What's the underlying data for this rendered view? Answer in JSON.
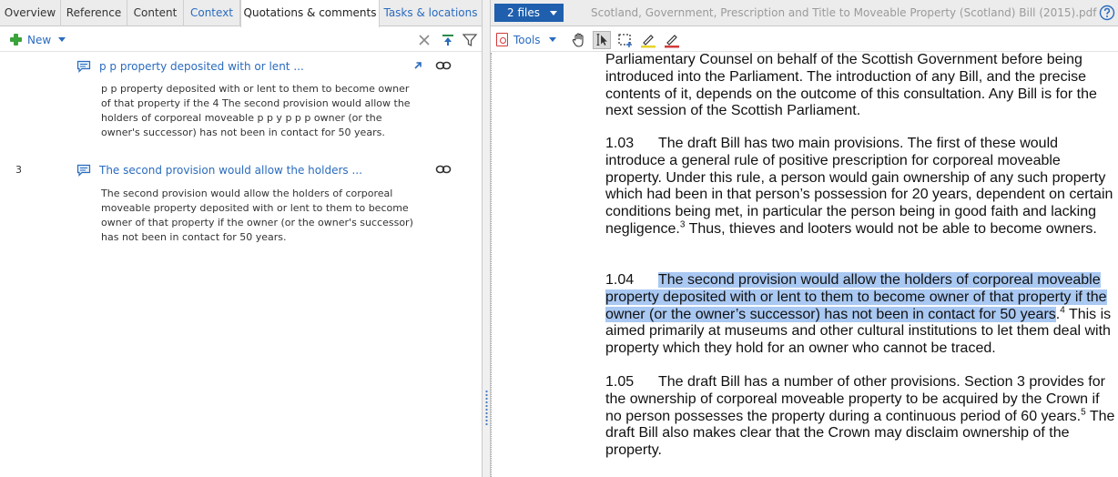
{
  "left_tabs": [
    "Overview",
    "Reference",
    "Content",
    "Context",
    "Quotations & comments",
    "Tasks & locations"
  ],
  "left_toolbar": {
    "new_label": "New"
  },
  "entries": [
    {
      "number": "",
      "title": "p p property deposited with or lent ...",
      "body": "p p property deposited with or lent to them to become owner of that property if the 4 The second provision would allow the holders of corporeal moveable p p y p p p owner (or the owner's successor) has not been in contact for 50 years."
    },
    {
      "number": "3",
      "title": "The second provision would allow the holders ...",
      "body": "The second provision would allow the holders of corporeal moveable property deposited with or lent to them to become owner of that property if the owner (or the owner's successor) has not been in contact for 50 years."
    }
  ],
  "right_header": {
    "files_label": "2 files",
    "doc_title": "Scotland, Government, Prescription and Title to Moveable Property (Scotland) Bill (2015).pdf"
  },
  "right_toolbar": {
    "tools_label": "Tools"
  },
  "document": {
    "p0": "Parliamentary Counsel on behalf of the Scottish Government before being introduced into the Parliament.    The introduction of any Bill, and the precise contents of it, depends on the outcome of this consultation.  Any Bill is for the next session of the Scottish Parliament.",
    "p1_num": "1.03",
    "p1_text": "The draft Bill has two main provisions. The first of these would introduce a general rule of positive prescription for corporeal moveable property. Under this rule, a person would gain ownership of any such property which had been in that person’s possession for 20 years, dependent on certain conditions being met, in particular the person being in good faith and lacking  negligence.",
    "p1_sup": "3",
    "p1_tail": " Thus, thieves and looters would not be able to become owners.",
    "p2_num": "1.04",
    "p2_highlight": "The second provision would allow the holders of corporeal moveable property deposited with or lent to them to become owner of that property if the owner (or the owner’s successor) has not been in contact for 50 years",
    "p2_after_hl": ".",
    "p2_sup": "4",
    "p2_tail": " This is aimed primarily at museums and other cultural institutions to let them deal with property which they hold for an owner who cannot be traced.",
    "p3_num": "1.05",
    "p3_text": "The draft Bill has a number of other provisions. Section 3 provides for the ownership of corporeal moveable property to be acquired by the Crown if no person possesses the property during a continuous period of 60 years.",
    "p3_sup": "5",
    "p3_tail": " The draft Bill also makes clear that the Crown may disclaim ownership of the property."
  },
  "colors": {
    "accent": "#1f5fad",
    "link": "#2a6bbf",
    "highlight": "#a9c8f2"
  },
  "icons": [
    "plus-icon",
    "close-icon",
    "sort-icon",
    "filter-icon",
    "comment-icon",
    "link-icon",
    "open-arrow-icon",
    "pdf-icon",
    "hand-tool-icon",
    "text-select-icon",
    "area-select-icon",
    "highlighter-icon",
    "highlighter-red-icon",
    "help-icon"
  ]
}
